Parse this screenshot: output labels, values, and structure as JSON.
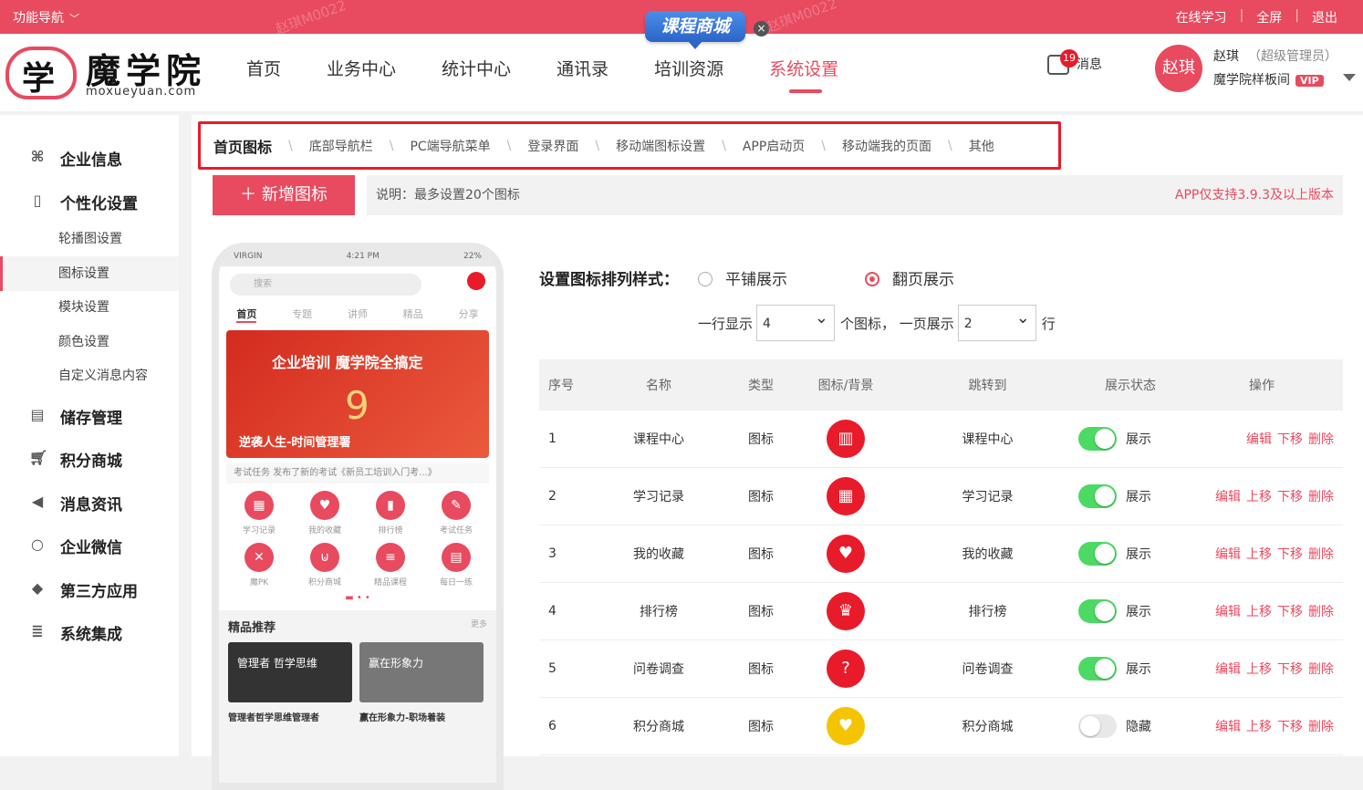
{
  "topbar": {
    "func_nav": "功能导航",
    "right_links": [
      "在线学习",
      "全屏",
      "退出"
    ],
    "watermark": "赵琪M0022"
  },
  "promo": {
    "label": "课程商城",
    "close_icon": "close-icon"
  },
  "logo": {
    "char": "学",
    "name": "魔学院",
    "url": "moxueyuan.com"
  },
  "nav": [
    "首页",
    "业务中心",
    "统计中心",
    "通讯录",
    "培训资源",
    "系统设置"
  ],
  "nav_active": "系统设置",
  "message": {
    "label": "消息",
    "count": "19"
  },
  "user": {
    "avatar": "赵琪",
    "name": "赵琪",
    "role": "（超级管理员）",
    "org": "魔学院样板间",
    "vip": "VIP"
  },
  "sidebar": {
    "groups": [
      {
        "label": "企业信息",
        "icon": "command-icon"
      },
      {
        "label": "个性化设置",
        "icon": "phone-icon"
      },
      {
        "label": "储存管理",
        "icon": "storage-icon"
      },
      {
        "label": "积分商城",
        "icon": "cart-icon"
      },
      {
        "label": "消息资讯",
        "icon": "speaker-icon"
      },
      {
        "label": "企业微信",
        "icon": "chat-icon"
      },
      {
        "label": "第三方应用",
        "icon": "box-icon"
      },
      {
        "label": "系统集成",
        "icon": "database-icon"
      }
    ],
    "sub_items": [
      "轮播图设置",
      "图标设置",
      "模块设置",
      "颜色设置",
      "自定义消息内容"
    ],
    "sub_active": "图标设置"
  },
  "tabs": [
    "首页图标",
    "底部导航栏",
    "PC端导航菜单",
    "登录界面",
    "移动端图标设置",
    "APP启动页",
    "移动端我的页面",
    "其他"
  ],
  "tab_active": "首页图标",
  "add_button": "新增图标",
  "note": "说明：最多设置20个图标",
  "version_note": "APP仅支持3.9.3及以上版本",
  "phone": {
    "status_left": "VIRGIN",
    "status_time": "4:21 PM",
    "status_right": "22%",
    "search": "搜索",
    "tabs": [
      "首页",
      "专题",
      "讲师",
      "精品",
      "分享"
    ],
    "banner_title": "企业培训 魔学院全搞定",
    "banner_num": "9",
    "banner_sub": "逆袭人生-时间管理署",
    "task": "考试任务  发布了新的考试《新员工培训入门考...》",
    "grid": [
      "学习记录",
      "我的收藏",
      "排行榜",
      "考试任务",
      "魔PK",
      "积分商城",
      "精品课程",
      "每日一练"
    ],
    "rec_title": "精品推荐",
    "rec_more": "更多",
    "cards": [
      "管理者 哲学思维",
      "赢在形象力"
    ],
    "card_titles": [
      "管理者哲学思维管理者",
      "赢在形象力-职场着装"
    ]
  },
  "style_setting": {
    "label": "设置图标排列样式：",
    "options": [
      "平铺展示",
      "翻页展示"
    ],
    "selected": "翻页展示"
  },
  "row_setting": {
    "prefix": "一行显示",
    "per_row": "4",
    "mid": "个图标， 一页展示",
    "rows": "2",
    "suffix": "行"
  },
  "table": {
    "headers": [
      "序号",
      "名称",
      "类型",
      "图标/背景",
      "跳转到",
      "展示状态",
      "操作"
    ],
    "rows": [
      {
        "no": "1",
        "name": "课程中心",
        "type": "图标",
        "icon": "book-icon",
        "color": "#e81b2a",
        "jump": "课程中心",
        "on": true,
        "status": "展示",
        "ops": [
          "编辑",
          "下移",
          "删除"
        ]
      },
      {
        "no": "2",
        "name": "学习记录",
        "type": "图标",
        "icon": "calendar-icon",
        "color": "#e81b2a",
        "jump": "学习记录",
        "on": true,
        "status": "展示",
        "ops": [
          "编辑",
          "上移",
          "下移",
          "删除"
        ]
      },
      {
        "no": "3",
        "name": "我的收藏",
        "type": "图标",
        "icon": "heart-icon",
        "color": "#e81b2a",
        "jump": "我的收藏",
        "on": true,
        "status": "展示",
        "ops": [
          "编辑",
          "上移",
          "下移",
          "删除"
        ]
      },
      {
        "no": "4",
        "name": "排行榜",
        "type": "图标",
        "icon": "trophy-icon",
        "color": "#e81b2a",
        "jump": "排行榜",
        "on": true,
        "status": "展示",
        "ops": [
          "编辑",
          "上移",
          "下移",
          "删除"
        ]
      },
      {
        "no": "5",
        "name": "问卷调查",
        "type": "图标",
        "icon": "question-icon",
        "color": "#e81b2a",
        "jump": "问卷调查",
        "on": true,
        "status": "展示",
        "ops": [
          "编辑",
          "上移",
          "下移",
          "删除"
        ]
      },
      {
        "no": "6",
        "name": "积分商城",
        "type": "图标",
        "icon": "heart-icon",
        "color": "#f5c400",
        "jump": "积分商城",
        "on": false,
        "status": "隐藏",
        "ops": [
          "编辑",
          "上移",
          "下移",
          "删除"
        ]
      }
    ]
  }
}
